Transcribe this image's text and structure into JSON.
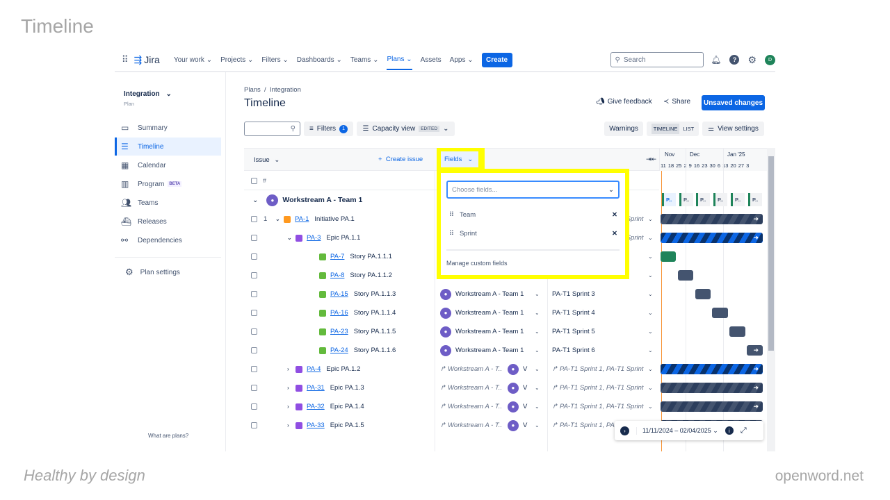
{
  "slide": {
    "title": "Timeline",
    "footer_left": "Healthy by design",
    "footer_right": "openword.net"
  },
  "nav": {
    "product": "Jira",
    "items": [
      "Your work ⌄",
      "Projects ⌄",
      "Filters ⌄",
      "Dashboards ⌄",
      "Teams ⌄",
      "Plans ⌄",
      "Assets",
      "Apps ⌄"
    ],
    "active": "Plans ⌄",
    "create": "Create",
    "search_placeholder": "Search",
    "avatar": "D"
  },
  "sidebar": {
    "plan_name": "Integration",
    "plan_sub": "Plan",
    "items": [
      {
        "label": "Summary",
        "icon": "summary-icon"
      },
      {
        "label": "Timeline",
        "icon": "timeline-icon",
        "active": true
      },
      {
        "label": "Calendar",
        "icon": "calendar-icon"
      },
      {
        "label": "Program",
        "icon": "program-icon",
        "badge": "BETA"
      },
      {
        "label": "Teams",
        "icon": "teams-icon"
      },
      {
        "label": "Releases",
        "icon": "releases-icon"
      },
      {
        "label": "Dependencies",
        "icon": "dependencies-icon"
      }
    ],
    "settings": "Plan settings",
    "help": "What are plans?"
  },
  "header": {
    "breadcrumb": [
      "Plans",
      "Integration"
    ],
    "title": "Timeline",
    "feedback": "Give feedback",
    "share": "Share",
    "unsaved": "Unsaved changes"
  },
  "toolbar": {
    "filters": "Filters",
    "filter_count": "1",
    "capacity": "Capacity view",
    "edited": "EDITED",
    "warnings": "Warnings",
    "timeline": "TIMELINE",
    "list": "LIST",
    "view_settings": "View settings"
  },
  "table": {
    "issue_header": "Issue",
    "create_issue": "Create issue",
    "hash": "#",
    "fields": "Fields",
    "group": "Workstream A - Team 1",
    "rows": [
      {
        "num": "1",
        "key": "PA-1",
        "title": "Initiative PA.1",
        "type": "initiative",
        "indent": 0,
        "expand": "open",
        "team": "",
        "sprint": "PA-T1 Sprint 1, PA-T1 Sprint",
        "rolled": true,
        "bar": "str-dark"
      },
      {
        "key": "PA-3",
        "title": "Epic PA.1.1",
        "type": "epic",
        "indent": 1,
        "expand": "open",
        "team": "",
        "sprint": "PA-T1 Sprint 1, PA-T1 Sprint",
        "rolled": true,
        "bar": "str-blue"
      },
      {
        "key": "PA-7",
        "title": "Story PA.1.1.1",
        "type": "story",
        "indent": 2,
        "team": "",
        "sprint": "",
        "bar": "green"
      },
      {
        "key": "PA-8",
        "title": "Story PA.1.1.2",
        "type": "story",
        "indent": 2,
        "team": "",
        "sprint": "",
        "bar": "slate"
      },
      {
        "key": "PA-15",
        "title": "Story PA.1.1.3",
        "type": "story",
        "indent": 2,
        "team": "Workstream A - Team 1",
        "sprint": "PA-T1 Sprint 3",
        "bar": "slate"
      },
      {
        "key": "PA-16",
        "title": "Story PA.1.1.4",
        "type": "story",
        "indent": 2,
        "team": "Workstream A - Team 1",
        "sprint": "PA-T1 Sprint 4",
        "bar": "slate"
      },
      {
        "key": "PA-23",
        "title": "Story PA.1.1.5",
        "type": "story",
        "indent": 2,
        "team": "Workstream A - Team 1",
        "sprint": "PA-T1 Sprint 5",
        "bar": "slate"
      },
      {
        "key": "PA-24",
        "title": "Story PA.1.1.6",
        "type": "story",
        "indent": 2,
        "team": "Workstream A - Team 1",
        "sprint": "PA-T1 Sprint 6",
        "bar": "slate-arrow"
      },
      {
        "key": "PA-4",
        "title": "Epic PA.1.2",
        "type": "epic",
        "indent": 1,
        "expand": "closed",
        "team": "Workstream A - T...",
        "sprint": "PA-T1 Sprint 1, PA-T1 Sprint",
        "rolled": true,
        "bar": "str-blue"
      },
      {
        "key": "PA-31",
        "title": "Epic PA.1.3",
        "type": "epic",
        "indent": 1,
        "expand": "closed",
        "team": "Workstream A - T...",
        "sprint": "PA-T1 Sprint 1, PA-T1 Sprint",
        "rolled": true,
        "bar": "str-dark"
      },
      {
        "key": "PA-32",
        "title": "Epic PA.1.4",
        "type": "epic",
        "indent": 1,
        "expand": "closed",
        "team": "Workstream A - T...",
        "sprint": "PA-T1 Sprint 1, PA-T1 Sprint",
        "rolled": true,
        "bar": "str-dark"
      },
      {
        "key": "PA-33",
        "title": "Epic PA.1.5",
        "type": "epic",
        "indent": 1,
        "expand": "closed",
        "team": "Workstream A - T...",
        "sprint": "PA-T1 Sprint 1, PA",
        "rolled": true,
        "bar": "str-dark"
      }
    ]
  },
  "fields_panel": {
    "placeholder": "Choose fields...",
    "fields": [
      "Team",
      "Sprint"
    ],
    "manage": "Manage custom fields",
    "highlight": "#ffff00"
  },
  "timeline": {
    "months": [
      "Nov",
      "Dec",
      "Jan '25"
    ],
    "weeks": [
      "11",
      "18",
      "25",
      "2",
      "9",
      "16",
      "23",
      "30",
      "6",
      "13",
      "20",
      "27",
      "3"
    ],
    "sprint_chip": "P..",
    "date_range": "11/11/2024 – 02/04/2025"
  },
  "colors": {
    "brand": "#0c66e4",
    "initiative": "#ff991f",
    "epic": "#904ee2",
    "story": "#63ba3c",
    "team_avatar": "#6e5dc6",
    "today": "#f79233"
  }
}
